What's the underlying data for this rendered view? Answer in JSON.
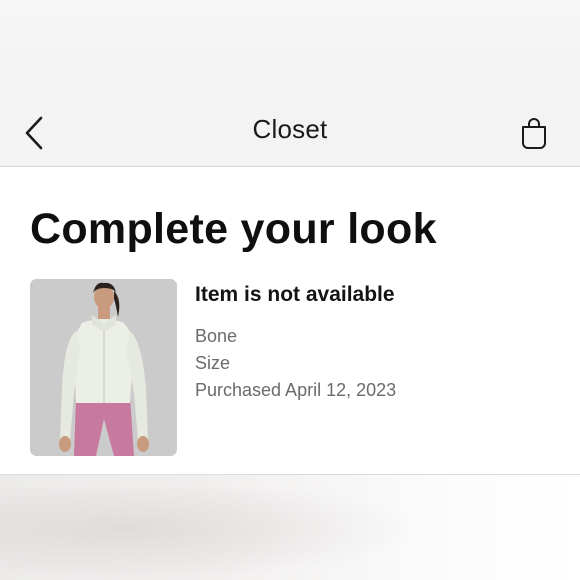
{
  "nav": {
    "title": "Closet",
    "back_icon": "chevron-left-icon",
    "bag_icon": "shopping-bag-icon"
  },
  "section": {
    "heading": "Complete your look"
  },
  "product": {
    "availability": "Item is not available",
    "color": "Bone",
    "size": "Size",
    "purchased": "Purchased April 12, 2023",
    "image_icon": "product-photo"
  },
  "colors": {
    "jacket": "#ecefe6",
    "leggings": "#c7799f",
    "photo_background": "#cbcbcb",
    "divider": "#d6d6d6"
  }
}
